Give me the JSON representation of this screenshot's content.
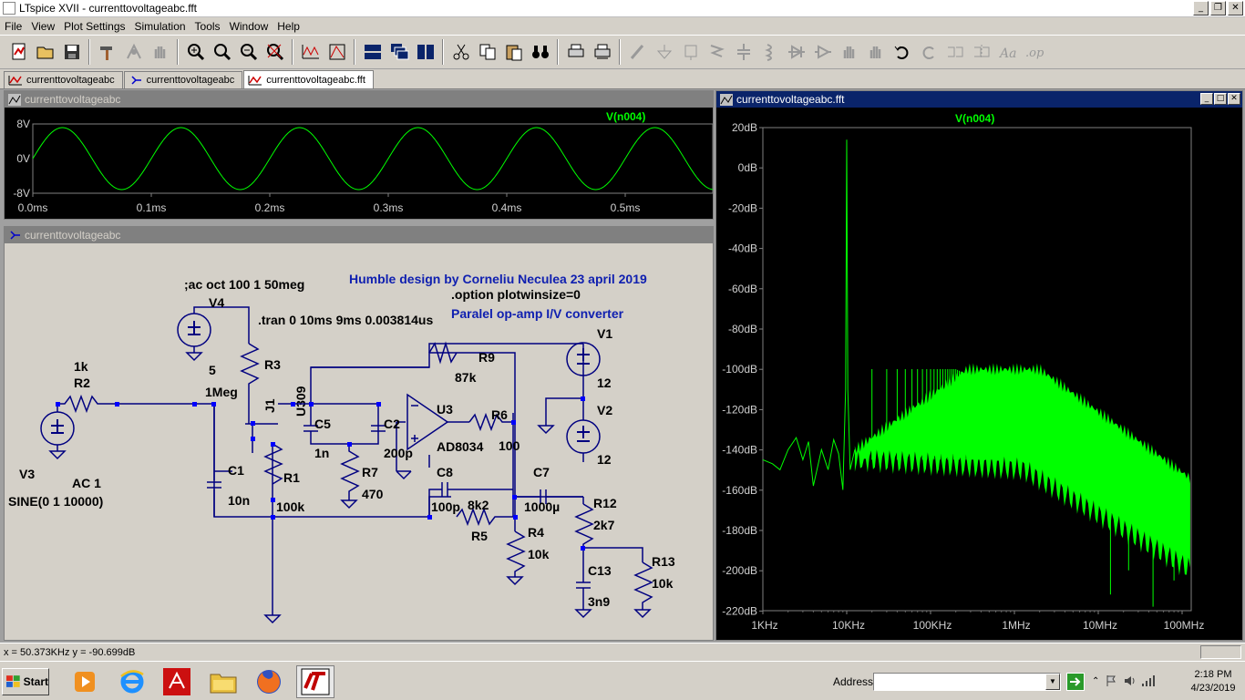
{
  "window": {
    "title": "LTspice XVII - currenttovoltageabc.fft",
    "controls": [
      "_",
      "❐",
      "✕"
    ]
  },
  "menu": [
    "File",
    "View",
    "Plot Settings",
    "Simulation",
    "Tools",
    "Window",
    "Help"
  ],
  "tabs": [
    {
      "label": "currenttovoltageabc",
      "icon": "plot-icon"
    },
    {
      "label": "currenttovoltageabc",
      "icon": "schematic-icon"
    },
    {
      "label": "currenttovoltageabc.fft",
      "icon": "plot-icon"
    }
  ],
  "transient_window": {
    "title": "currenttovoltageabc",
    "trace": "V(n004)",
    "trace_color": "#00ff00",
    "y_ticks": [
      "8V",
      "0V",
      "-8V"
    ],
    "x_ticks": [
      "0.0ms",
      "0.1ms",
      "0.2ms",
      "0.3ms",
      "0.4ms",
      "0.5ms"
    ]
  },
  "schematic_window": {
    "title": "currenttovoltageabc",
    "wire_color": "#0000cc",
    "component_color": "#000080",
    "texts": {
      "credit": "Humble design by Corneliu Neculea 23 april 2019",
      "option": ".option plotwinsize=0",
      "desc": "Paralel op-amp I/V converter",
      "ac": ";ac oct 100 1 50meg",
      "tran": ".tran 0 10ms 9ms 0.003814us",
      "v4": "V4",
      "v4val": "5",
      "r3": "R3",
      "r3val": "1Meg",
      "j1": "J1",
      "j1val": "U309",
      "r2val": "1k",
      "r2": "R2",
      "v3": "V3",
      "v3ac": "AC 1",
      "v3sine": "SINE(0 1 10000)",
      "c1": "C1",
      "c1val": "10n",
      "r1": "R1",
      "r1val": "100k",
      "c5": "C5",
      "c5val": "1n",
      "c2": "C2",
      "c2val": "200p",
      "r7": "R7",
      "r7val": "470",
      "u3": "U3",
      "u3val": "AD8034",
      "r9": "R9",
      "r9val": "87k",
      "r6": "R6",
      "r6val": "100",
      "v1": "V1",
      "v1val": "12",
      "v2": "V2",
      "v2val": "12",
      "c8": "C8",
      "c8val": "100p",
      "r5": "R5",
      "r5val": "8k2",
      "c7": "C7",
      "c7val": "1000µ",
      "r4": "R4",
      "r4val": "10k",
      "r12": "R12",
      "r12val": "2k7",
      "r13": "R13",
      "r13val": "10k",
      "c13": "C13",
      "c13val": "3n9"
    }
  },
  "fft_window": {
    "title": "currenttovoltageabc.fft",
    "trace": "V(n004)",
    "trace_color": "#00ff00",
    "y_ticks": [
      "20dB",
      "0dB",
      "-20dB",
      "-40dB",
      "-60dB",
      "-80dB",
      "-100dB",
      "-120dB",
      "-140dB",
      "-160dB",
      "-180dB",
      "-200dB",
      "-220dB"
    ],
    "x_ticks": [
      "1KHz",
      "10KHz",
      "100KHz",
      "1MHz",
      "10MHz",
      "100MHz"
    ]
  },
  "status": {
    "cursor": "x = 50.373KHz    y = -90.699dB"
  },
  "taskbar": {
    "start": "Start",
    "address_label": "Address",
    "address_value": "",
    "time": "2:18 PM",
    "date": "4/23/2019",
    "apps": [
      "media-player-icon",
      "ie-icon",
      "acrobat-icon",
      "explorer-icon",
      "firefox-icon",
      "ltspice-icon"
    ]
  }
}
